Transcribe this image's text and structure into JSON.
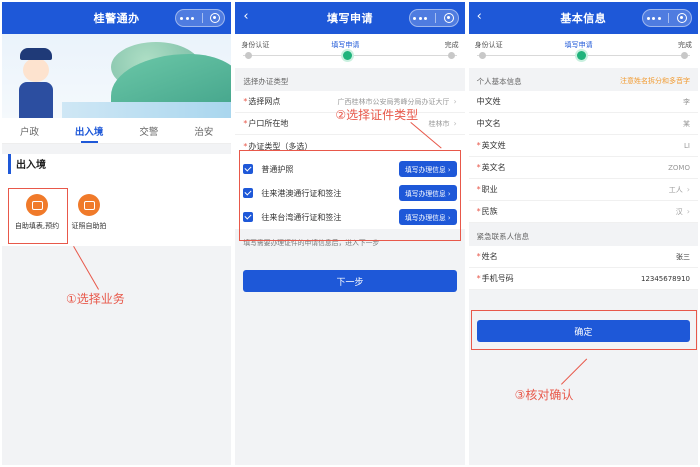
{
  "panel1": {
    "title": "桂警通办",
    "tabs": [
      {
        "label": "户政",
        "active": false
      },
      {
        "label": "出入境",
        "active": true
      },
      {
        "label": "交警",
        "active": false
      },
      {
        "label": "治安",
        "active": false
      }
    ],
    "section_title": "出入境",
    "services": [
      {
        "label": "自助填表,预约",
        "icon": "camera-icon"
      },
      {
        "label": "证照自助拍",
        "icon": "camera-icon"
      }
    ],
    "annotation": "①选择业务"
  },
  "panel2": {
    "back": "‹",
    "title": "填写申请",
    "steps": [
      {
        "label": "身份认证",
        "state": "done"
      },
      {
        "label": "填写申请",
        "state": "current"
      },
      {
        "label": "完成",
        "state": "todo"
      }
    ],
    "group_title": "选择办证类型",
    "fields": [
      {
        "label": "选择网点",
        "value": "广西桂林市公安局秀峰分局办证大厅",
        "required": true
      },
      {
        "label": "户口所在地",
        "value": "桂林市",
        "required": true
      },
      {
        "label": "办证类型（多选）",
        "value": "",
        "required": true
      }
    ],
    "options": [
      {
        "label": "普通护照",
        "button": "填写办理信息 ›",
        "checked": true
      },
      {
        "label": "往来港澳通行证和签注",
        "button": "填写办理信息 ›",
        "checked": true
      },
      {
        "label": "往来台湾通行证和签注",
        "button": "填写办理信息 ›",
        "checked": true
      }
    ],
    "hint": "填写需要办理证件的申请信息后，进入下一步",
    "next_button": "下一步",
    "annotation": "②选择证件类型"
  },
  "panel3": {
    "back": "‹",
    "title": "基本信息",
    "steps": [
      {
        "label": "身份认证",
        "state": "done"
      },
      {
        "label": "填写申请",
        "state": "current"
      },
      {
        "label": "完成",
        "state": "todo"
      }
    ],
    "basic_group": "个人基本信息",
    "basic_warning": "注意姓名拆分和多音字",
    "basic_fields": [
      {
        "label": "中文姓",
        "value": "李",
        "required": false,
        "chevron": false
      },
      {
        "label": "中文名",
        "value": "某",
        "required": false,
        "chevron": false
      },
      {
        "label": "英文姓",
        "value": "LI",
        "required": true,
        "chevron": false
      },
      {
        "label": "英文名",
        "value": "ZOMO",
        "required": true,
        "chevron": false
      },
      {
        "label": "职业",
        "value": "工人",
        "required": true,
        "chevron": true
      },
      {
        "label": "民族",
        "value": "汉",
        "required": true,
        "chevron": true
      }
    ],
    "contact_group": "紧急联系人信息",
    "contact_fields": [
      {
        "label": "姓名",
        "value": "张三",
        "required": true
      },
      {
        "label": "手机号码",
        "value": "12345678910",
        "required": true
      }
    ],
    "confirm_button": "确定",
    "annotation": "③核对确认"
  },
  "colors": {
    "brand_blue": "#1e58d8",
    "annotation_red": "#e8584a",
    "step_green": "#21b37c",
    "service_orange": "#f07a2a",
    "warning_orange": "#f29a2e"
  }
}
